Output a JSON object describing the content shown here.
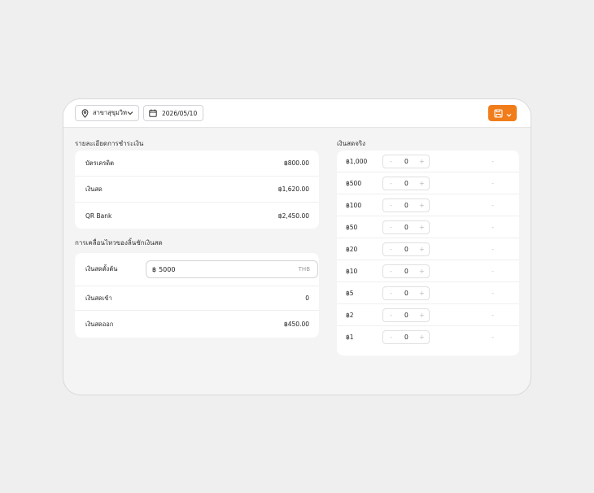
{
  "toolbar": {
    "branch_label": "สาขาสุขุมวิท",
    "date_value": "2026/05/10"
  },
  "payments": {
    "title": "รายละเอียดการชำระเงิน",
    "rows": [
      {
        "label": "บัตรเครดิต",
        "value": "฿800.00"
      },
      {
        "label": "เงินสด",
        "value": "฿1,620.00"
      },
      {
        "label": "QR Bank",
        "value": "฿2,450.00"
      }
    ]
  },
  "drawer": {
    "title": "การเคลื่อนไหวของลิ้นชักเงินสด",
    "opening_label": "เงินสดตั้งต้น",
    "opening_prefix": "฿",
    "opening_value": "5000",
    "opening_unit": "THB",
    "cash_in_label": "เงินสดเข้า",
    "cash_in_value": "0",
    "cash_out_label": "เงินสดออก",
    "cash_out_value": "฿450.00"
  },
  "actual_cash": {
    "title": "เงินสดจริง",
    "denominations": [
      {
        "label": "฿1,000",
        "qty": "0",
        "total": "-"
      },
      {
        "label": "฿500",
        "qty": "0",
        "total": "-"
      },
      {
        "label": "฿100",
        "qty": "0",
        "total": "-"
      },
      {
        "label": "฿50",
        "qty": "0",
        "total": "-"
      },
      {
        "label": "฿20",
        "qty": "0",
        "total": "-"
      },
      {
        "label": "฿10",
        "qty": "0",
        "total": "-"
      },
      {
        "label": "฿5",
        "qty": "0",
        "total": "-"
      },
      {
        "label": "฿2",
        "qty": "0",
        "total": "-"
      },
      {
        "label": "฿1",
        "qty": "0",
        "total": "-"
      }
    ],
    "minus_glyph": "-",
    "plus_glyph": "+"
  },
  "colors": {
    "accent": "#f07d1a"
  }
}
